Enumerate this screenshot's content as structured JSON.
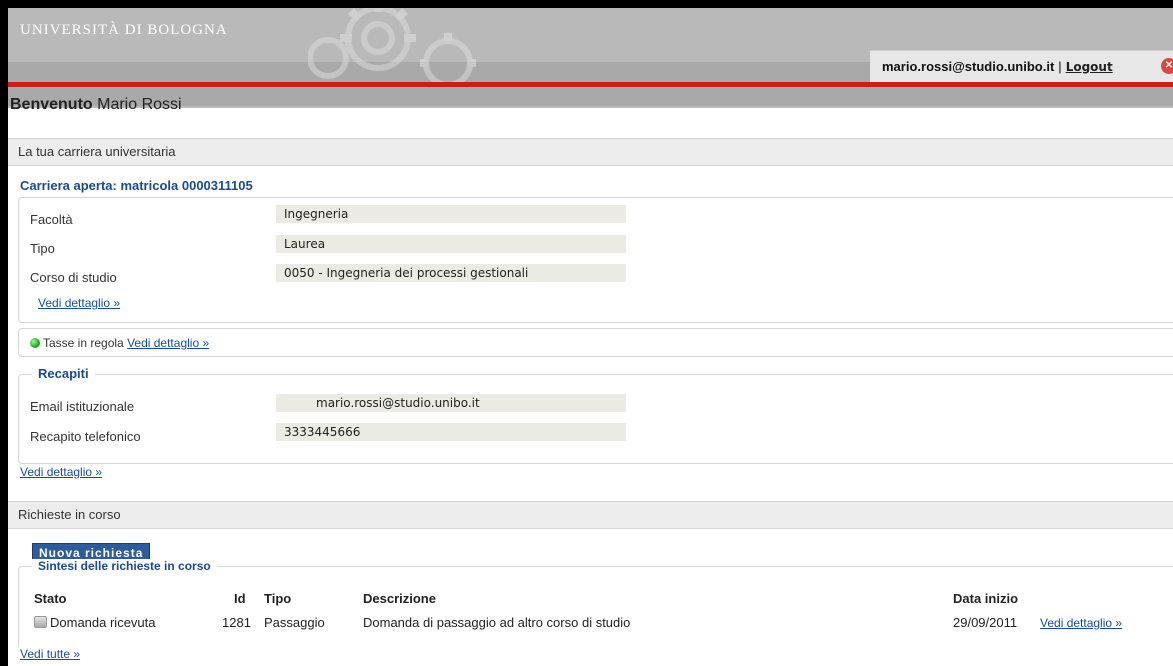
{
  "header": {
    "university": "UNIVERSITÀ DI BOLOGNA",
    "user_email": "mario.rossi@studio.unibo.it",
    "separator": "|",
    "logout_label": "Logout"
  },
  "welcome": {
    "prefix": "Benvenuto",
    "name": "Mario Rossi"
  },
  "career": {
    "section_title": "La tua carriera universitaria",
    "open_career": "Carriera aperta: matricola 0000311105",
    "fields": [
      {
        "label": "Facoltà",
        "value": "Ingegneria"
      },
      {
        "label": "Tipo",
        "value": "Laurea"
      },
      {
        "label": "Corso di studio",
        "value": "0050 - Ingegneria dei processi gestionali"
      }
    ],
    "details_link": "Vedi dettaglio »",
    "fees_text": "Tasse in regola",
    "fees_link": "Vedi dettaglio »"
  },
  "contacts": {
    "title": "Recapiti",
    "fields": [
      {
        "label": "Email istituzionale",
        "value": "mario.rossi@studio.unibo.it"
      },
      {
        "label": "Recapito telefonico",
        "value": "3333445666"
      }
    ],
    "details_link": "Vedi dettaglio »"
  },
  "requests": {
    "section_title": "Richieste in corso",
    "new_button": "Nuova richiesta",
    "summary_title": "Sintesi delle richieste in corso",
    "columns": {
      "stato": "Stato",
      "id": "Id",
      "tipo": "Tipo",
      "descrizione": "Descrizione",
      "data_inizio": "Data inizio"
    },
    "rows": [
      {
        "stato": "Domanda ricevuta",
        "id": "1281",
        "tipo": "Passaggio",
        "descrizione": "Domanda di passaggio ad altro corso di studio",
        "data_inizio": "29/09/2011",
        "link": "Vedi dettaglio »"
      }
    ],
    "all_link": "Vedi tutte »"
  }
}
